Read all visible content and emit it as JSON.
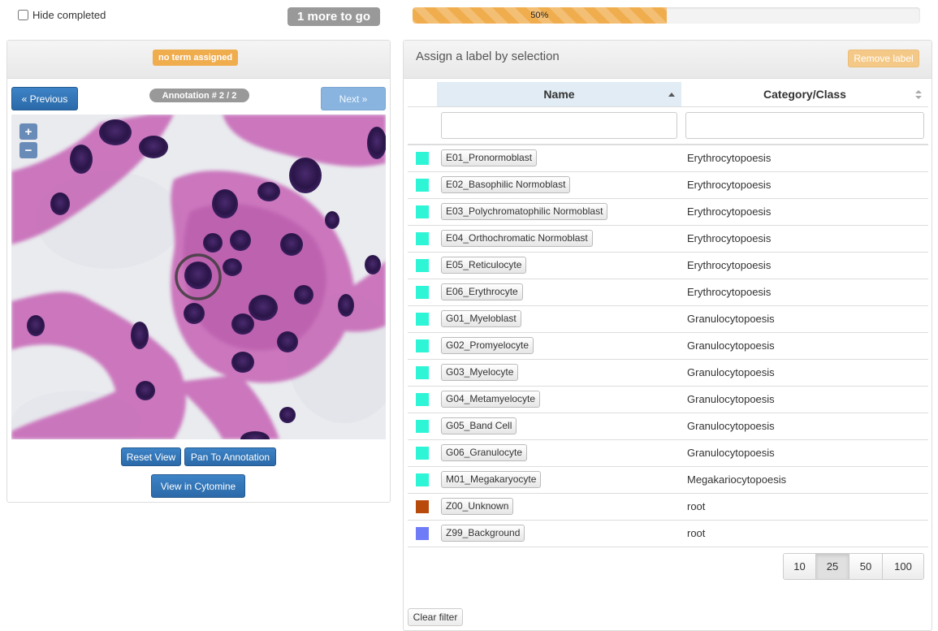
{
  "header": {
    "hide_completed_label": "Hide completed",
    "hide_completed_checked": false,
    "remaining_badge": "1 more to go",
    "progress_label": "50%",
    "progress_fraction": 0.5
  },
  "left_panel": {
    "term_badge": "no term assigned",
    "prev_label": "« Previous",
    "next_label": "Next »",
    "annotation_label": "Annotation # 2 / 2",
    "zoom_in": "+",
    "zoom_out": "−",
    "reset_view_label": "Reset View",
    "pan_label": "Pan To Annotation",
    "cytomine_label": "View in Cytomine"
  },
  "right_panel": {
    "title": "Assign a label by selection",
    "remove_label": "Remove label",
    "columns": {
      "name": "Name",
      "category": "Category/Class"
    },
    "name_filter_value": "",
    "category_filter_value": "",
    "rows": [
      {
        "color": "#2ef5d6",
        "name": "E01_Pronormoblast",
        "category": "Erythrocytopoesis"
      },
      {
        "color": "#2ef5d6",
        "name": "E02_Basophilic Normoblast",
        "category": "Erythrocytopoesis"
      },
      {
        "color": "#2ef5d6",
        "name": "E03_Polychromatophilic Normoblast",
        "category": "Erythrocytopoesis"
      },
      {
        "color": "#2ef5d6",
        "name": "E04_Orthochromatic Normoblast",
        "category": "Erythrocytopoesis"
      },
      {
        "color": "#2ef5d6",
        "name": "E05_Reticulocyte",
        "category": "Erythrocytopoesis"
      },
      {
        "color": "#2ef5d6",
        "name": "E06_Erythrocyte",
        "category": "Erythrocytopoesis"
      },
      {
        "color": "#2ef5d6",
        "name": "G01_Myeloblast",
        "category": "Granulocytopoesis"
      },
      {
        "color": "#2ef5d6",
        "name": "G02_Promyelocyte",
        "category": "Granulocytopoesis"
      },
      {
        "color": "#2ef5d6",
        "name": "G03_Myelocyte",
        "category": "Granulocytopoesis"
      },
      {
        "color": "#2ef5d6",
        "name": "G04_Metamyelocyte",
        "category": "Granulocytopoesis"
      },
      {
        "color": "#2ef5d6",
        "name": "G05_Band Cell",
        "category": "Granulocytopoesis"
      },
      {
        "color": "#2ef5d6",
        "name": "G06_Granulocyte",
        "category": "Granulocytopoesis"
      },
      {
        "color": "#2ef5d6",
        "name": "M01_Megakaryocyte",
        "category": "Megakariocytopoesis"
      },
      {
        "color": "#b84a0c",
        "name": "Z00_Unknown",
        "category": "root"
      },
      {
        "color": "#6e7cf7",
        "name": "Z99_Background",
        "category": "root"
      }
    ],
    "page_sizes": [
      "10",
      "25",
      "50",
      "100"
    ],
    "active_page_size": "25",
    "clear_filter_label": "Clear filter"
  },
  "colors": {
    "accent_orange": "#f0ad4e",
    "primary_blue": "#2b6aa9",
    "sorted_column_bg": "#e1ecf4"
  }
}
